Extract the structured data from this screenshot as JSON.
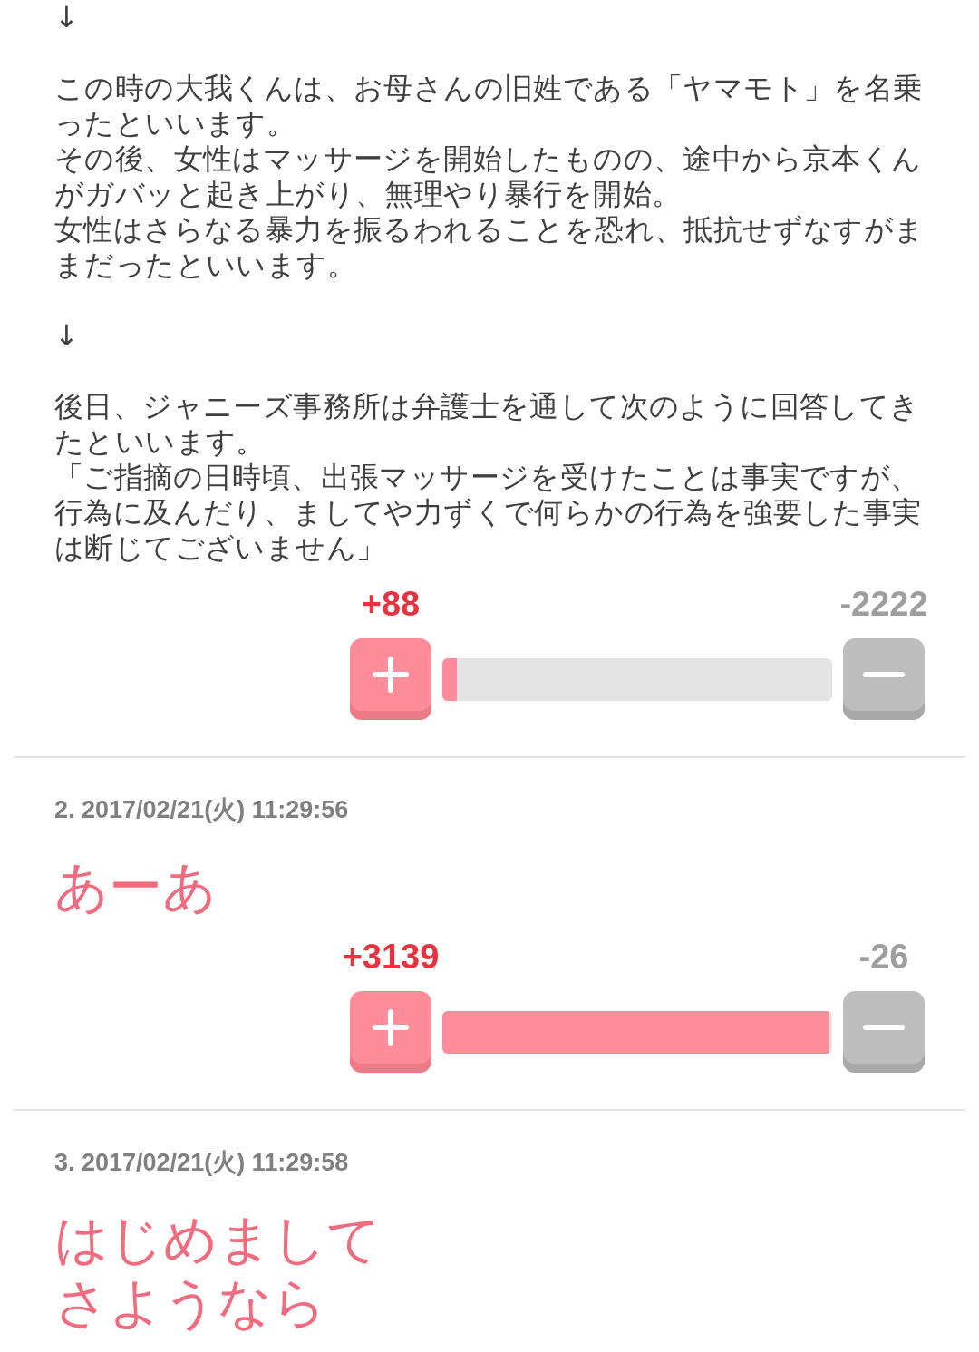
{
  "comments": [
    {
      "kind": "plain",
      "blocks": [
        {
          "lines": [
            "↓"
          ]
        },
        {
          "lines": [
            "この時の大我くんは、お母さんの旧姓である「ヤマモト」を名乗ったといいます。",
            "その後、女性はマッサージを開始したものの、途中から京本くんがガバッと起き上がり、無理やり暴行を開始。",
            "女性はさらなる暴力を振るわれることを恐れ、抵抗せずなすがままだったといいます。"
          ]
        },
        {
          "lines": [
            "↓"
          ]
        },
        {
          "lines": [
            "後日、ジャニーズ事務所は弁護士を通して次のように回答してきたといいます。",
            "「ご指摘の日時頃、出張マッサージを受けたことは事実ですが、行為に及んだり、ましてや力ずくで何らかの行為を強要した事実は断じてございません」"
          ]
        }
      ],
      "votes": {
        "plus": "+88",
        "minus": "-2222",
        "level": 0.038
      }
    },
    {
      "kind": "large",
      "header": "2. 2017/02/21(火) 11:29:56",
      "blocks": [
        {
          "lines": [
            "あーあ"
          ]
        }
      ],
      "votes": {
        "plus": "+3139",
        "minus": "-26",
        "level": 0.992
      }
    },
    {
      "kind": "large",
      "header": "3. 2017/02/21(火) 11:29:58",
      "blocks": [
        {
          "lines": [
            "はじめまして",
            "さようなら"
          ]
        }
      ]
    }
  ]
}
